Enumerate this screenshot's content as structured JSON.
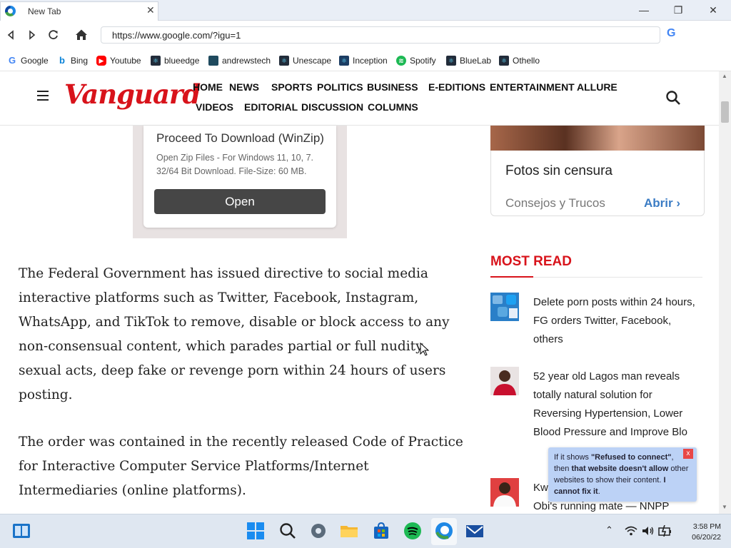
{
  "browser": {
    "tab_title": "New Tab",
    "tab_close": "✕",
    "window_controls": {
      "minimize": "—",
      "restore": "❐",
      "close": "✕"
    },
    "url": "https://www.google.com/?igu=1",
    "search_engine_icon": "G"
  },
  "bookmarks": [
    {
      "label": "Google",
      "icon": "google-icon",
      "color": "#4285f4"
    },
    {
      "label": "Bing",
      "icon": "bing-icon",
      "color": "#0a83d8"
    },
    {
      "label": "Youtube",
      "icon": "youtube-icon",
      "color": "#ff0000"
    },
    {
      "label": "blueedge",
      "icon": "react-icon",
      "color": "#222c3a"
    },
    {
      "label": "andrewstech",
      "icon": "terminal-icon",
      "color": "#1f4a5e"
    },
    {
      "label": "Unescape",
      "icon": "react-icon",
      "color": "#222c3a"
    },
    {
      "label": "Inception",
      "icon": "react-icon",
      "color": "#1c3d63"
    },
    {
      "label": "Spotify",
      "icon": "spotify-icon",
      "color": "#1db954"
    },
    {
      "label": "BlueLab",
      "icon": "react-icon",
      "color": "#222c3a"
    },
    {
      "label": "Othello",
      "icon": "react-icon",
      "color": "#222c3a"
    }
  ],
  "site": {
    "logo": "Vanguard",
    "brand_color": "#d8131b",
    "menu_row1": [
      "HOME",
      "NEWS",
      "SPORTS",
      "POLITICS",
      "BUSINESS",
      "E-EDITIONS",
      "ENTERTAINMENT",
      "ALLURE"
    ],
    "menu_row2": [
      "VIDEOS",
      "EDITORIAL",
      "DISCUSSION",
      "COLUMNS"
    ]
  },
  "ad": {
    "title": "Proceed To Download (WinZip)",
    "description": "Open Zip Files - For Windows 11, 10, 7. 32/64 Bit Download. File-Size: 60 MB.",
    "button": "Open"
  },
  "article": {
    "paragraphs": [
      "The Federal Government has issued directive to social media interactive platforms such as Twitter, Facebook, Instagram, WhatsApp, and TikTok to remove, disable or block access to any non-consensual content, which parades partial or full nudity, sexual acts, deep fake or revenge porn within 24 hours of users posting.",
      "The order was contained in the recently released Code of Practice for Interactive Computer Service Platforms/Internet Intermediaries (online platforms)."
    ]
  },
  "sidebar": {
    "promo_title": "Fotos sin censura",
    "promo_subtitle": "Consejos y Trucos",
    "promo_button": "Abrir",
    "most_read_heading": "MOST READ",
    "most_read": [
      "Delete porn posts within 24 hours, FG orders Twitter, Facebook, others",
      "52 year old Lagos man reveals totally natural solution for Reversing Hypertension, Lower Blood Pressure and Improve Blo",
      "Kw",
      "Obi's running mate — NNPP"
    ]
  },
  "tooltip": {
    "part1": "If it shows ",
    "quote": "\"Refused to connect\"",
    "part2": ", then ",
    "bold2": "that website doesn't allow",
    "part3": " other websites to show their content. ",
    "bold3": "I cannot fix it",
    "end": ".",
    "close": "x"
  },
  "taskbar": {
    "time": "3:58 PM",
    "date": "06/20/22",
    "apps": [
      "widgets-icon",
      "start-icon",
      "search-icon",
      "settings-icon",
      "file-explorer-icon",
      "store-icon",
      "spotify-icon",
      "edge-icon",
      "mail-icon"
    ]
  }
}
